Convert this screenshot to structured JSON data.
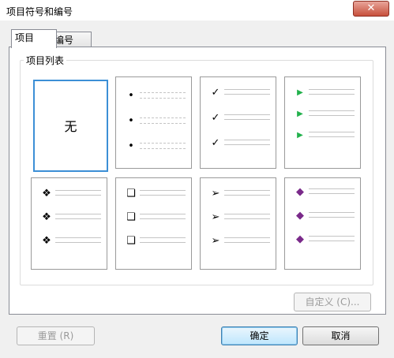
{
  "window": {
    "title": "项目符号和编号",
    "close_glyph": "✕"
  },
  "tabs": [
    {
      "label": "项目"
    },
    {
      "label": "编号"
    }
  ],
  "group": {
    "label": "项目列表"
  },
  "gallery": {
    "none_label": "无",
    "styles": [
      {
        "icon": "none"
      },
      {
        "icon": "bullet-dot-icon",
        "glyph": "•"
      },
      {
        "icon": "checkmark-icon",
        "glyph": "✓"
      },
      {
        "icon": "green-arrow-icon",
        "glyph": "▶",
        "color": "#22b14c"
      },
      {
        "icon": "four-diamond-icon",
        "glyph": "❖"
      },
      {
        "icon": "hollow-square-icon",
        "glyph": "❑"
      },
      {
        "icon": "arrowhead-icon",
        "glyph": "➢"
      },
      {
        "icon": "purple-book-icon",
        "glyph": "◆",
        "color": "#7a2a8a"
      }
    ]
  },
  "buttons": {
    "customize": "自定义 (C)...",
    "reset": "重置 (R)",
    "ok": "确定",
    "cancel": "取消"
  }
}
